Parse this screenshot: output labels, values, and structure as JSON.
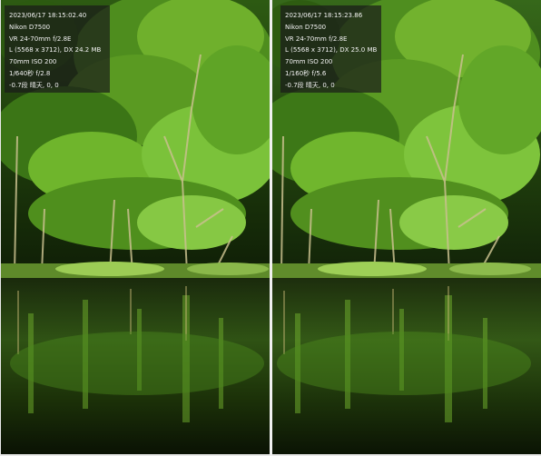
{
  "viewers": [
    {
      "side": "left",
      "exif": [
        "2023/06/17 18:15:02.40",
        "Nikon D7500",
        "VR 24-70mm f/2.8E",
        "L (5568 x 3712), DX  24.2 MB",
        "70mm   ISO 200",
        "1/640秒   f/2.8",
        "-0.7段   晴天, 0, 0"
      ]
    },
    {
      "side": "right",
      "exif": [
        "2023/06/17 18:15:23.86",
        "Nikon D7500",
        "VR 24-70mm f/2.8E",
        "L (5568 x 3712), DX  25.0 MB",
        "70mm   ISO 200",
        "1/160秒   f/5.6",
        "-0.7段   晴天, 0, 0"
      ]
    }
  ],
  "colors": {
    "foliage_bright": "#7ec435",
    "foliage_mid": "#3f7d1a",
    "forest_shadow": "#14240a",
    "water_dark": "#0b1206",
    "bank_grass": "#8ab84a",
    "overlay_bg": "#191919"
  }
}
